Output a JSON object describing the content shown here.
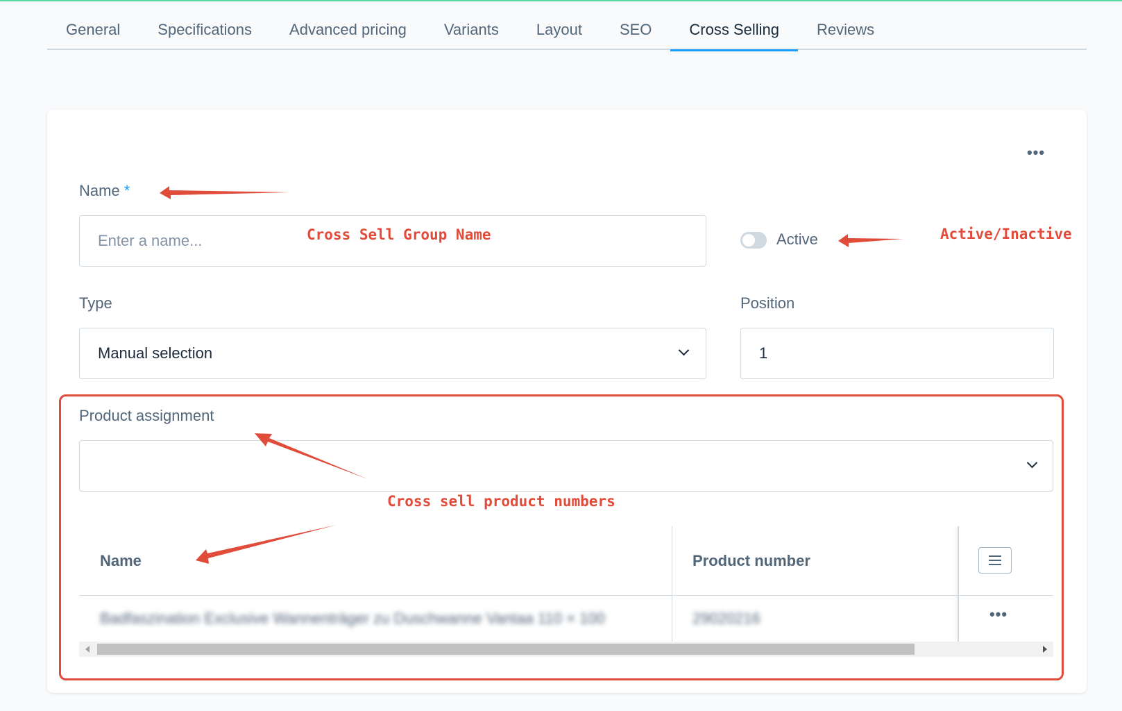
{
  "tabs": [
    {
      "label": "General"
    },
    {
      "label": "Specifications"
    },
    {
      "label": "Advanced pricing"
    },
    {
      "label": "Variants"
    },
    {
      "label": "Layout"
    },
    {
      "label": "SEO"
    },
    {
      "label": "Cross Selling"
    },
    {
      "label": "Reviews"
    }
  ],
  "active_tab": "Cross Selling",
  "card": {
    "menu_label": "•••",
    "name": {
      "label": "Name",
      "required_marker": "*",
      "placeholder": "Enter a name...",
      "value": ""
    },
    "active": {
      "label": "Active",
      "checked": false
    },
    "type": {
      "label": "Type",
      "selected": "Manual selection"
    },
    "position": {
      "label": "Position",
      "value": "1"
    },
    "product_assignment": {
      "label": "Product assignment",
      "selected": ""
    },
    "grid": {
      "columns": [
        "Name",
        "Product number"
      ],
      "rows": [
        {
          "name": "Badfaszination Exclusive Wannenträger zu Duschwanne Vantaa 110 × 100",
          "product_number": "29020216",
          "menu": "•••"
        }
      ]
    }
  },
  "annotations": {
    "group_name": "Cross Sell Group Name",
    "active_inactive": "Active/Inactive",
    "product_numbers": "Cross sell product numbers",
    "color": "#e04b3a"
  },
  "colors": {
    "accent": "#189eff",
    "top_bar": "#57d9a3",
    "annotation": "#e04b3a"
  }
}
